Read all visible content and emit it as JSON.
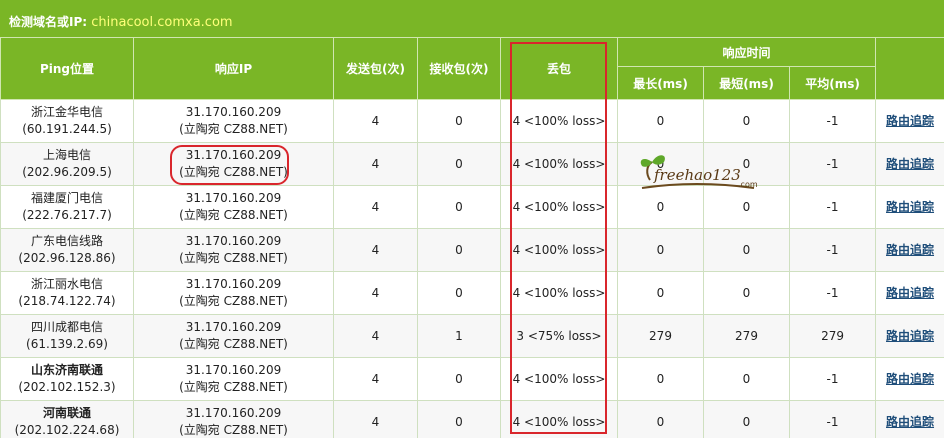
{
  "header": {
    "label": "检测域名或IP:",
    "domain": "chinacool.comxa.com"
  },
  "columns": {
    "location": "Ping位置",
    "ip": "响应IP",
    "sent": "发送包(次)",
    "received": "接收包(次)",
    "loss": "丢包",
    "response_time": "响应时间",
    "max": "最长(ms)",
    "min": "最短(ms)",
    "avg": "平均(ms)"
  },
  "rows": [
    {
      "loc": "浙江金华电信",
      "loc_ip": "(60.191.244.5)",
      "ip": "31.170.160.209",
      "ip_note": "(立陶宛 CZ88.NET)",
      "sent": "4",
      "recv": "0",
      "loss": "4 <100% loss>",
      "max": "0",
      "min": "0",
      "avg": "-1",
      "trace": "路由追踪"
    },
    {
      "loc": "上海电信",
      "loc_ip": "(202.96.209.5)",
      "ip": "31.170.160.209",
      "ip_note": "(立陶宛 CZ88.NET)",
      "sent": "4",
      "recv": "0",
      "loss": "4 <100% loss>",
      "max": "0",
      "min": "0",
      "avg": "-1",
      "trace": "路由追踪"
    },
    {
      "loc": "福建厦门电信",
      "loc_ip": "(222.76.217.7)",
      "ip": "31.170.160.209",
      "ip_note": "(立陶宛 CZ88.NET)",
      "sent": "4",
      "recv": "0",
      "loss": "4 <100% loss>",
      "max": "0",
      "min": "0",
      "avg": "-1",
      "trace": "路由追踪"
    },
    {
      "loc": "广东电信线路",
      "loc_ip": "(202.96.128.86)",
      "ip": "31.170.160.209",
      "ip_note": "(立陶宛 CZ88.NET)",
      "sent": "4",
      "recv": "0",
      "loss": "4 <100% loss>",
      "max": "0",
      "min": "0",
      "avg": "-1",
      "trace": "路由追踪"
    },
    {
      "loc": "浙江丽水电信",
      "loc_ip": "(218.74.122.74)",
      "ip": "31.170.160.209",
      "ip_note": "(立陶宛 CZ88.NET)",
      "sent": "4",
      "recv": "0",
      "loss": "4 <100% loss>",
      "max": "0",
      "min": "0",
      "avg": "-1",
      "trace": "路由追踪"
    },
    {
      "loc": "四川成都电信",
      "loc_ip": "(61.139.2.69)",
      "ip": "31.170.160.209",
      "ip_note": "(立陶宛 CZ88.NET)",
      "sent": "4",
      "recv": "1",
      "loss": "3 <75% loss>",
      "max": "279",
      "min": "279",
      "avg": "279",
      "trace": "路由追踪"
    },
    {
      "loc": "山东济南联通",
      "loc_ip": "(202.102.152.3)",
      "ip": "31.170.160.209",
      "ip_note": "(立陶宛 CZ88.NET)",
      "sent": "4",
      "recv": "0",
      "loss": "4 <100% loss>",
      "max": "0",
      "min": "0",
      "avg": "-1",
      "trace": "路由追踪",
      "bold": true
    },
    {
      "loc": "河南联通",
      "loc_ip": "(202.102.224.68)",
      "ip": "31.170.160.209",
      "ip_note": "(立陶宛 CZ88.NET)",
      "sent": "4",
      "recv": "0",
      "loss": "4 <100% loss>",
      "max": "0",
      "min": "0",
      "avg": "-1",
      "trace": "路由追踪",
      "bold": true
    }
  ],
  "watermark": {
    "text": "freehao123",
    "suffix": ".com"
  },
  "colors": {
    "header_bg": "#7ab626",
    "domain_text": "#ffff7a",
    "highlight": "#d9262c",
    "link": "#1f4e7a"
  }
}
